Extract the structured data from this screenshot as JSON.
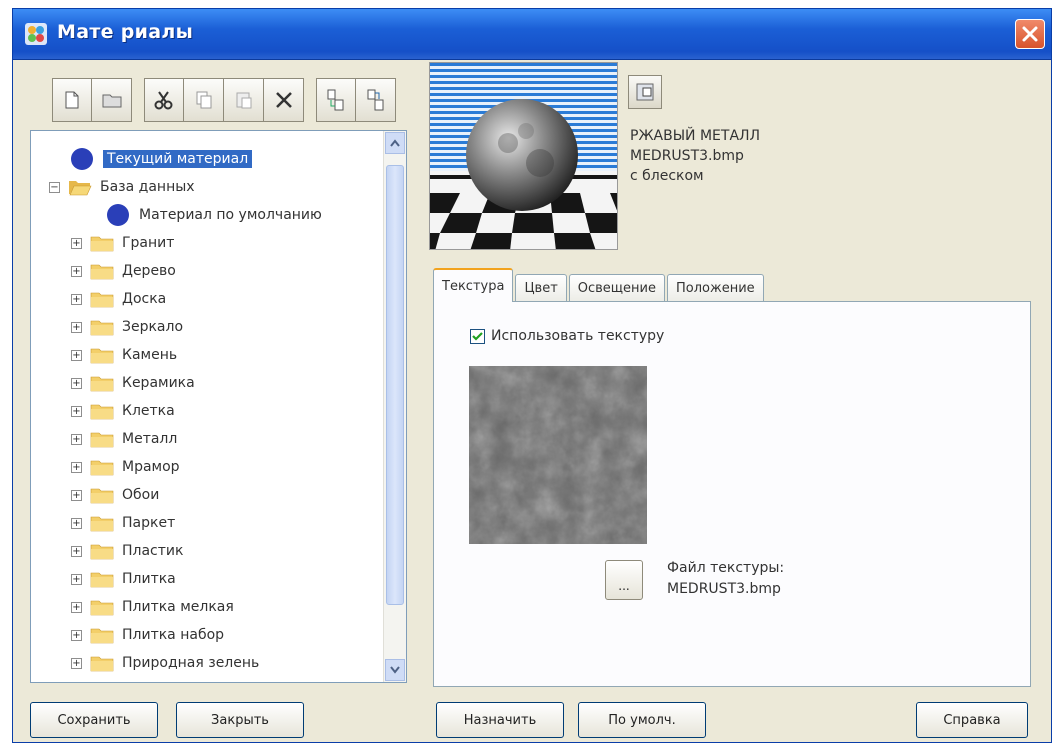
{
  "window": {
    "title": "Мате риалы",
    "close": "close"
  },
  "toolbar": {
    "buttons": [
      "new",
      "open",
      "cut",
      "copy",
      "paste",
      "delete",
      "import",
      "export"
    ]
  },
  "tree": {
    "items": [
      {
        "label": "Текущий материал",
        "icon": "material-dot",
        "selected": true
      },
      {
        "label": "База данных",
        "icon": "folder-open",
        "expanded": true
      },
      {
        "label": "Материал по умолчанию",
        "icon": "material-dot"
      },
      {
        "label": "Гранит",
        "icon": "folder"
      },
      {
        "label": "Дерево",
        "icon": "folder"
      },
      {
        "label": "Доска",
        "icon": "folder"
      },
      {
        "label": "Зеркало",
        "icon": "folder"
      },
      {
        "label": "Камень",
        "icon": "folder"
      },
      {
        "label": "Керамика",
        "icon": "folder"
      },
      {
        "label": "Клетка",
        "icon": "folder"
      },
      {
        "label": "Металл",
        "icon": "folder"
      },
      {
        "label": "Мрамор",
        "icon": "folder"
      },
      {
        "label": "Обои",
        "icon": "folder"
      },
      {
        "label": "Паркет",
        "icon": "folder"
      },
      {
        "label": "Пластик",
        "icon": "folder"
      },
      {
        "label": "Плитка",
        "icon": "folder"
      },
      {
        "label": "Плитка мелкая",
        "icon": "folder"
      },
      {
        "label": "Плитка набор",
        "icon": "folder"
      },
      {
        "label": "Природная зелень",
        "icon": "folder"
      }
    ]
  },
  "material": {
    "name": "РЖАВЫЙ МЕТАЛЛ",
    "file": "MEDRUST3.bmp",
    "finish": "с блеском"
  },
  "tabs": [
    "Текстура",
    "Цвет",
    "Освещение",
    "Положение"
  ],
  "texture_tab": {
    "use_texture_label": "Использовать текстуру",
    "use_texture_checked": true,
    "browse_label": "...",
    "file_label": "Файл текстуры:",
    "file_name": "MEDRUST3.bmp"
  },
  "buttons": {
    "save": "Сохранить",
    "close": "Закрыть",
    "assign": "Назначить",
    "default": "По умолч.",
    "help": "Справка"
  },
  "colors": {
    "titlebar": "#1b5fd6",
    "selection": "#316ac5",
    "material_dot": "#2a3fb8",
    "close_button": "#d8532c"
  }
}
